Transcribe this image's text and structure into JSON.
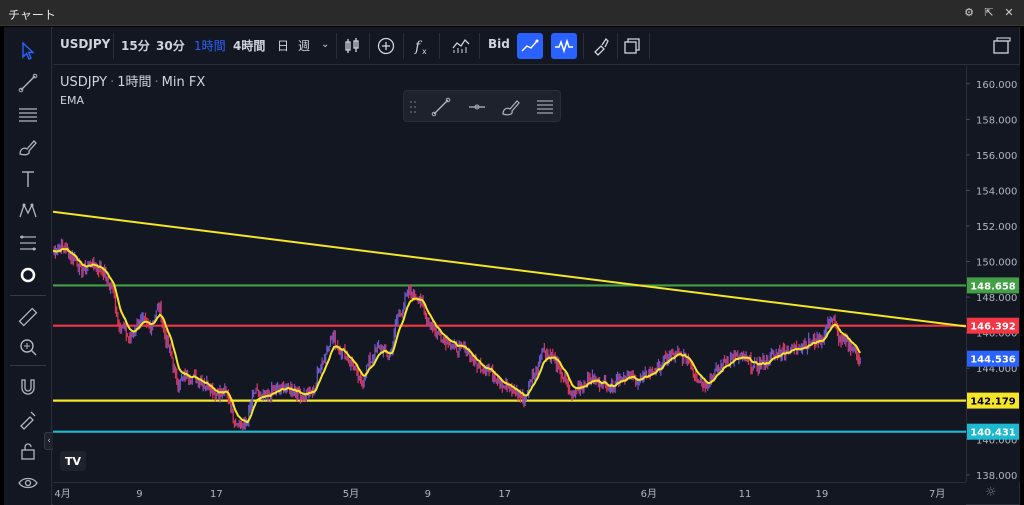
{
  "window": {
    "title": "チャート"
  },
  "toolbar": {
    "symbol": "USDJPY",
    "intervals": [
      "15分",
      "30分",
      "1時間",
      "4時間",
      "日",
      "週"
    ],
    "active_interval": "1時間",
    "bid_label": "Bid"
  },
  "legend": {
    "symbol": "USDJPY",
    "interval": "1時間",
    "source": "Min FX",
    "indicator": "EMA"
  },
  "colors": {
    "up": "#6a5acd",
    "down": "#e0365b",
    "ema": "#f5e62a",
    "green": "#43a047",
    "red": "#f23645",
    "yellow": "#f5e62a",
    "cyan": "#1fb8d1",
    "blue": "#2962ff"
  },
  "chart_data": {
    "type": "line",
    "title": "USDJPY · 1時間 · Min FX",
    "y_ticks": [
      "160.000",
      "158.000",
      "156.000",
      "154.000",
      "152.000",
      "150.000",
      "148.000",
      "146.000",
      "144.000",
      "142.000",
      "140.000",
      "138.000"
    ],
    "ylim": [
      137.6,
      161.0
    ],
    "x_tick_labels": [
      "4月",
      "9",
      "17",
      "5月",
      "9",
      "17",
      "6月",
      "11",
      "19",
      "7月"
    ],
    "x_tick_dates": [
      "2024-04-01",
      "2024-04-09",
      "2024-04-17",
      "2024-05-01",
      "2024-05-09",
      "2024-05-17",
      "2024-06-01",
      "2024-06-11",
      "2024-06-19",
      "2024-07-01"
    ],
    "xlim": [
      "2024-03-31",
      "2024-07-04"
    ],
    "series": [
      {
        "name": "USDJPY",
        "points": [
          [
            "2024-03-31",
            150.6
          ],
          [
            "2024-04-01",
            150.8
          ],
          [
            "2024-04-02",
            150.3
          ],
          [
            "2024-04-03",
            149.5
          ],
          [
            "2024-04-04",
            149.9
          ],
          [
            "2024-04-05",
            149.6
          ],
          [
            "2024-04-06",
            148.6
          ],
          [
            "2024-04-07",
            146.4
          ],
          [
            "2024-04-08",
            145.7
          ],
          [
            "2024-04-09",
            146.7
          ],
          [
            "2024-04-10",
            146.4
          ],
          [
            "2024-04-11",
            147.3
          ],
          [
            "2024-04-12",
            145.2
          ],
          [
            "2024-04-13",
            143.2
          ],
          [
            "2024-04-14",
            143.6
          ],
          [
            "2024-04-15",
            143.4
          ],
          [
            "2024-04-16",
            143.1
          ],
          [
            "2024-04-17",
            142.6
          ],
          [
            "2024-04-18",
            142.6
          ],
          [
            "2024-04-19",
            141.0
          ],
          [
            "2024-04-20",
            140.8
          ],
          [
            "2024-04-21",
            142.6
          ],
          [
            "2024-04-22",
            142.3
          ],
          [
            "2024-04-23",
            142.7
          ],
          [
            "2024-04-24",
            142.9
          ],
          [
            "2024-04-25",
            142.8
          ],
          [
            "2024-04-26",
            142.5
          ],
          [
            "2024-04-27",
            142.7
          ],
          [
            "2024-04-28",
            144.4
          ],
          [
            "2024-04-29",
            145.7
          ],
          [
            "2024-04-30",
            145.0
          ],
          [
            "2024-05-01",
            144.3
          ],
          [
            "2024-05-02",
            143.2
          ],
          [
            "2024-05-03",
            144.4
          ],
          [
            "2024-05-04",
            145.2
          ],
          [
            "2024-05-05",
            144.7
          ],
          [
            "2024-05-06",
            147.1
          ],
          [
            "2024-05-07",
            148.2
          ],
          [
            "2024-05-08",
            148.0
          ],
          [
            "2024-05-09",
            146.7
          ],
          [
            "2024-05-10",
            145.9
          ],
          [
            "2024-05-11",
            145.6
          ],
          [
            "2024-05-12",
            145.1
          ],
          [
            "2024-05-13",
            145.0
          ],
          [
            "2024-05-14",
            144.2
          ],
          [
            "2024-05-15",
            144.0
          ],
          [
            "2024-05-16",
            143.6
          ],
          [
            "2024-05-17",
            143.0
          ],
          [
            "2024-05-18",
            142.7
          ],
          [
            "2024-05-19",
            142.3
          ],
          [
            "2024-05-20",
            143.6
          ],
          [
            "2024-05-21",
            145.0
          ],
          [
            "2024-05-22",
            144.6
          ],
          [
            "2024-05-23",
            143.6
          ],
          [
            "2024-05-24",
            142.5
          ],
          [
            "2024-05-25",
            143.1
          ],
          [
            "2024-05-26",
            143.4
          ],
          [
            "2024-05-27",
            143.2
          ],
          [
            "2024-05-28",
            143.0
          ],
          [
            "2024-05-29",
            143.5
          ],
          [
            "2024-05-30",
            143.5
          ],
          [
            "2024-05-31",
            143.3
          ],
          [
            "2024-06-01",
            143.7
          ],
          [
            "2024-06-02",
            144.1
          ],
          [
            "2024-06-03",
            144.6
          ],
          [
            "2024-06-04",
            144.8
          ],
          [
            "2024-06-05",
            144.5
          ],
          [
            "2024-06-06",
            143.5
          ],
          [
            "2024-06-07",
            143.1
          ],
          [
            "2024-06-08",
            143.8
          ],
          [
            "2024-06-09",
            144.4
          ],
          [
            "2024-06-10",
            144.6
          ],
          [
            "2024-06-11",
            144.5
          ],
          [
            "2024-06-12",
            144.1
          ],
          [
            "2024-06-13",
            144.3
          ],
          [
            "2024-06-14",
            144.7
          ],
          [
            "2024-06-15",
            145.0
          ],
          [
            "2024-06-16",
            145.1
          ],
          [
            "2024-06-17",
            145.3
          ],
          [
            "2024-06-18",
            145.5
          ],
          [
            "2024-06-19",
            145.7
          ],
          [
            "2024-06-20",
            146.8
          ],
          [
            "2024-06-21",
            145.6
          ],
          [
            "2024-06-22",
            145.3
          ],
          [
            "2024-06-23",
            144.5
          ]
        ]
      },
      {
        "name": "EMA",
        "style": "line"
      }
    ],
    "horizontal_levels": [
      {
        "label": "148.658",
        "value": 148.658,
        "color": "#43a047"
      },
      {
        "label": "146.392",
        "value": 146.392,
        "color": "#f23645"
      },
      {
        "label": "144.536",
        "value": 144.536,
        "color": "#2962ff"
      },
      {
        "label": "142.179",
        "value": 142.179,
        "color": "#f5e62a"
      },
      {
        "label": "140.431",
        "value": 140.431,
        "color": "#1fb8d1"
      }
    ],
    "trendline": {
      "from": [
        "2024-03-31",
        152.8
      ],
      "to": [
        "2024-07-04",
        146.35
      ],
      "color": "#f5e62a"
    }
  }
}
